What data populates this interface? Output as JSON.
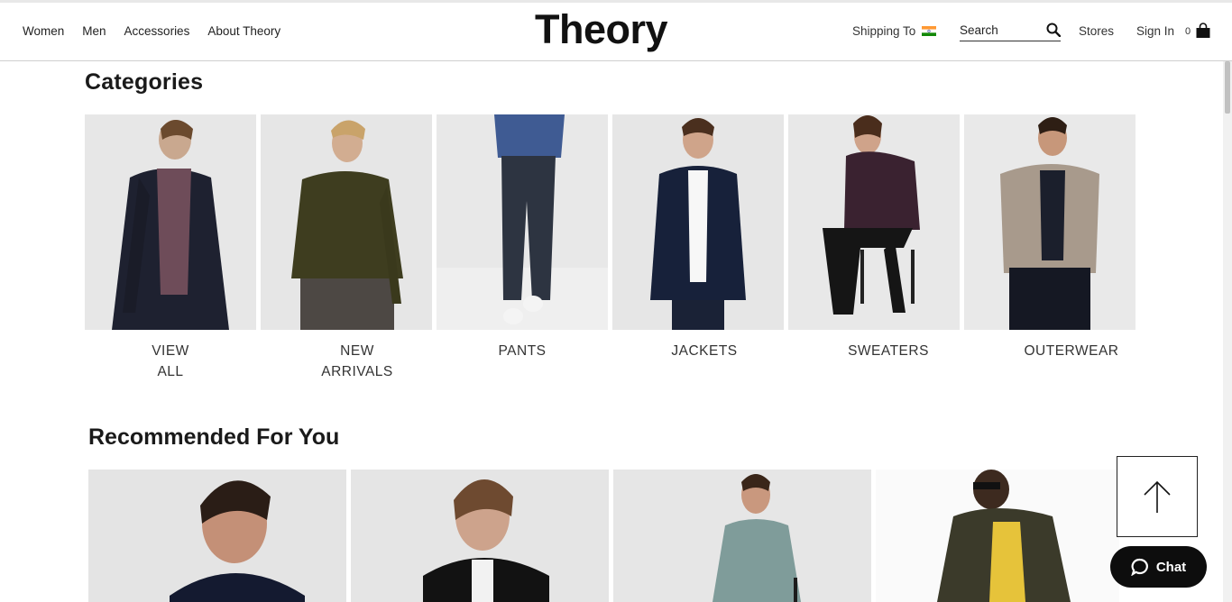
{
  "header": {
    "nav_left": [
      "Women",
      "Men",
      "Accessories",
      "About Theory"
    ],
    "logo": "Theory",
    "shipping_label": "Shipping To",
    "shipping_flag": "india-flag-icon",
    "search_placeholder": "Search",
    "stores": "Stores",
    "sign_in": "Sign In",
    "bag_count": "0"
  },
  "categories": {
    "title": "Categories",
    "items": [
      {
        "label_line1": "VIEW",
        "label_line2": "ALL"
      },
      {
        "label_line1": "NEW",
        "label_line2": "ARRIVALS"
      },
      {
        "label_line1": "PANTS",
        "label_line2": ""
      },
      {
        "label_line1": "JACKETS",
        "label_line2": ""
      },
      {
        "label_line1": "SWEATERS",
        "label_line2": ""
      },
      {
        "label_line1": "OUTERWEAR",
        "label_line2": ""
      }
    ]
  },
  "recommended": {
    "title": "Recommended For You"
  },
  "widgets": {
    "chat_label": "Chat"
  },
  "colors": {
    "accent": "#111111",
    "tile_bg": "#e6e6e6"
  }
}
